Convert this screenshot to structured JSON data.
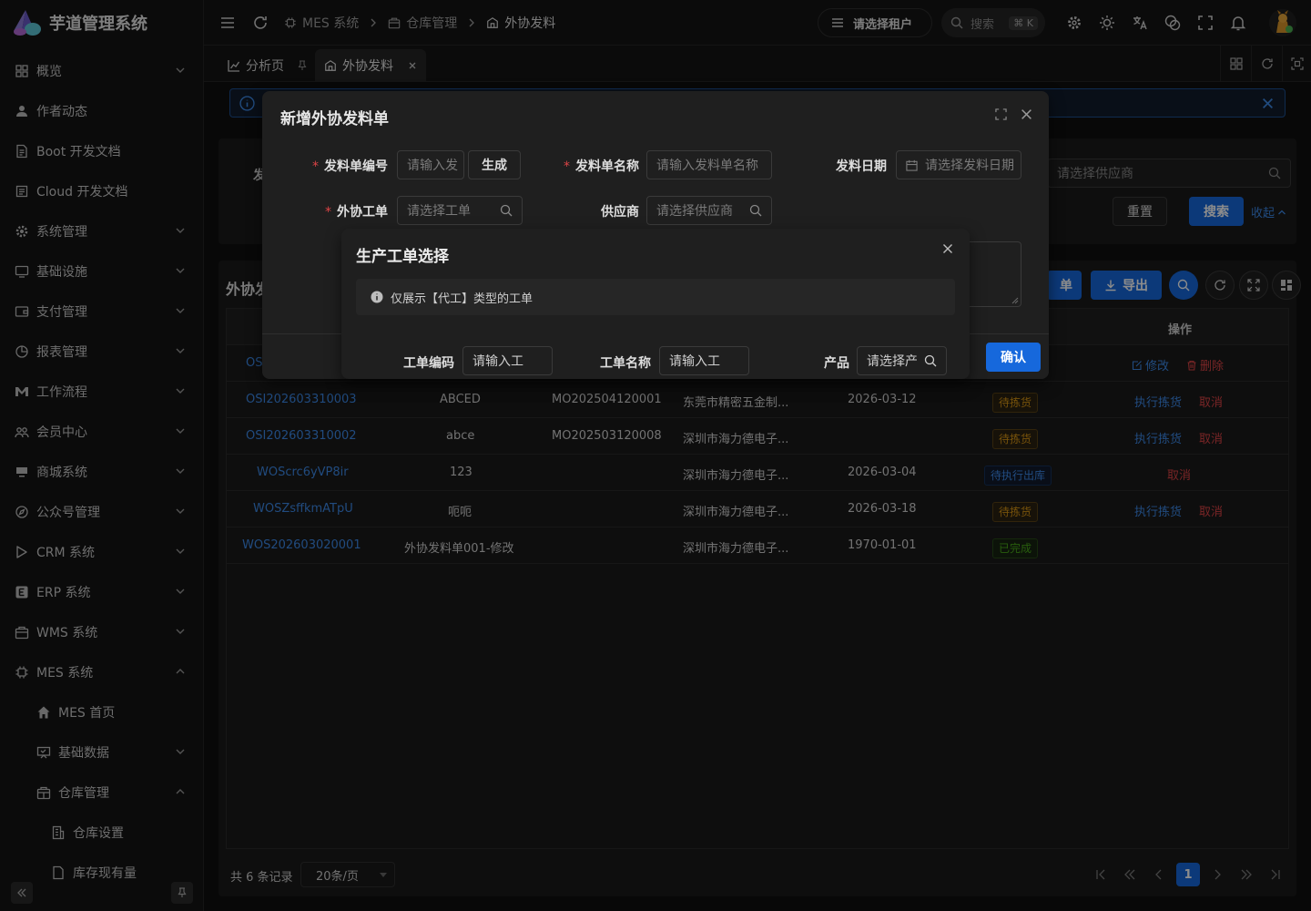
{
  "app": {
    "title": "芋道管理系统"
  },
  "sidebar": {
    "items": [
      {
        "label": "概览",
        "icon": "grid-icon",
        "chevron": "down"
      },
      {
        "label": "作者动态",
        "icon": "user-icon",
        "chevron": ""
      },
      {
        "label": "Boot 开发文档",
        "icon": "doc-icon",
        "chevron": ""
      },
      {
        "label": "Cloud 开发文档",
        "icon": "doc-icon",
        "chevron": ""
      },
      {
        "label": "系统管理",
        "icon": "gear-icon",
        "chevron": "down"
      },
      {
        "label": "基础设施",
        "icon": "monitor-icon",
        "chevron": "down"
      },
      {
        "label": "支付管理",
        "icon": "wallet-icon",
        "chevron": "down"
      },
      {
        "label": "报表管理",
        "icon": "pie-chart-icon",
        "chevron": "down"
      },
      {
        "label": "工作流程",
        "icon": "flow-icon",
        "chevron": "down"
      },
      {
        "label": "会员中心",
        "icon": "members-icon",
        "chevron": "down"
      },
      {
        "label": "商城系统",
        "icon": "shop-icon",
        "chevron": "down"
      },
      {
        "label": "公众号管理",
        "icon": "compass-icon",
        "chevron": "down"
      },
      {
        "label": "CRM 系统",
        "icon": "crm-icon",
        "chevron": "down"
      },
      {
        "label": "ERP 系统",
        "icon": "erp-icon",
        "chevron": "down"
      },
      {
        "label": "WMS 系统",
        "icon": "box-icon",
        "chevron": "down"
      },
      {
        "label": "MES 系统",
        "icon": "chip-icon",
        "chevron": "up"
      },
      {
        "label": "MES 首页",
        "icon": "home-icon",
        "chevron": "",
        "level": 2
      },
      {
        "label": "基础数据",
        "icon": "board-icon",
        "chevron": "down",
        "level": 2
      },
      {
        "label": "仓库管理",
        "icon": "warehouse-icon",
        "chevron": "up",
        "level": 2
      },
      {
        "label": "仓库设置",
        "icon": "building-icon",
        "chevron": "",
        "level": 3
      },
      {
        "label": "库存现有量",
        "icon": "doc-icon",
        "chevron": "",
        "level": 3
      }
    ]
  },
  "header": {
    "breadcrumb": [
      "MES 系统",
      "仓库管理",
      "外协发料"
    ],
    "tenant": "请选择租户",
    "search_placeholder": "搜索",
    "search_shortcut": "⌘ K"
  },
  "tabs": [
    {
      "label": "分析页",
      "active": false
    },
    {
      "label": "外协发料",
      "active": true
    }
  ],
  "main": {
    "search_partial_label": "发",
    "supplier_placeholder": "请选择供应商",
    "reset_label": "重置",
    "search_label": "搜索",
    "collapse_label": "收起",
    "table_title_partial": "外协发",
    "add_partial": "单",
    "export_label": "导出",
    "ops_header": "操作",
    "first_row_partial_code": "OS",
    "first_row_edit": "修改",
    "first_row_delete": "删除",
    "rows": [
      {
        "code": "OSI202603310003",
        "name": "ABCED",
        "work_order": "MO202504120001",
        "supplier": "东莞市精密五金制...",
        "date": "2026-03-12",
        "status": "待拣货",
        "status_type": "warn",
        "actions": [
          "执行拣货",
          "取消"
        ]
      },
      {
        "code": "OSI202603310002",
        "name": "abce",
        "work_order": "MO202503120008",
        "supplier": "深圳市海力德电子...",
        "date": "",
        "status": "待拣货",
        "status_type": "warn",
        "actions": [
          "执行拣货",
          "取消"
        ]
      },
      {
        "code": "WOScrc6yVP8ir",
        "name": "123",
        "work_order": "",
        "supplier": "深圳市海力德电子...",
        "date": "2026-03-04",
        "status": "待执行出库",
        "status_type": "proc",
        "actions": [
          "取消"
        ]
      },
      {
        "code": "WOSZsffkmATpU",
        "name": "呃呃",
        "work_order": "",
        "supplier": "深圳市海力德电子...",
        "date": "2026-03-18",
        "status": "待拣货",
        "status_type": "warn",
        "actions": [
          "执行拣货",
          "取消"
        ]
      },
      {
        "code": "WOS202603020001",
        "name": "外协发料单001-修改",
        "work_order": "",
        "supplier": "深圳市海力德电子...",
        "date": "1970-01-01",
        "status": "已完成",
        "status_type": "ok",
        "actions": []
      }
    ],
    "pager": {
      "total": "共 6 条记录",
      "page_size": "20条/页",
      "current_page": "1"
    }
  },
  "modal_issue": {
    "title": "新增外协发料单",
    "fields": {
      "code_label": "发料单编号",
      "code_placeholder": "请输入发",
      "generate_label": "生成",
      "name_label": "发料单名称",
      "name_placeholder": "请输入发料单名称",
      "date_label": "发料日期",
      "date_placeholder": "请选择发料日期",
      "wo_label": "外协工单",
      "wo_placeholder": "请选择工单",
      "supplier_label": "供应商",
      "supplier_placeholder": "请选择供应商"
    }
  },
  "modal_wo": {
    "title": "生产工单选择",
    "info": "仅展示【代工】类型的工单",
    "wo_code_label": "工单编码",
    "wo_code_placeholder": "请输入工",
    "wo_name_label": "工单名称",
    "wo_name_placeholder": "请输入工",
    "product_label": "产品",
    "product_placeholder": "请选择产",
    "confirm_label": "确认"
  },
  "colors": {
    "primary": "#1668dc",
    "link": "#3c89e8",
    "danger": "#dc4446",
    "warning": "#d89614",
    "success": "#49aa19"
  }
}
